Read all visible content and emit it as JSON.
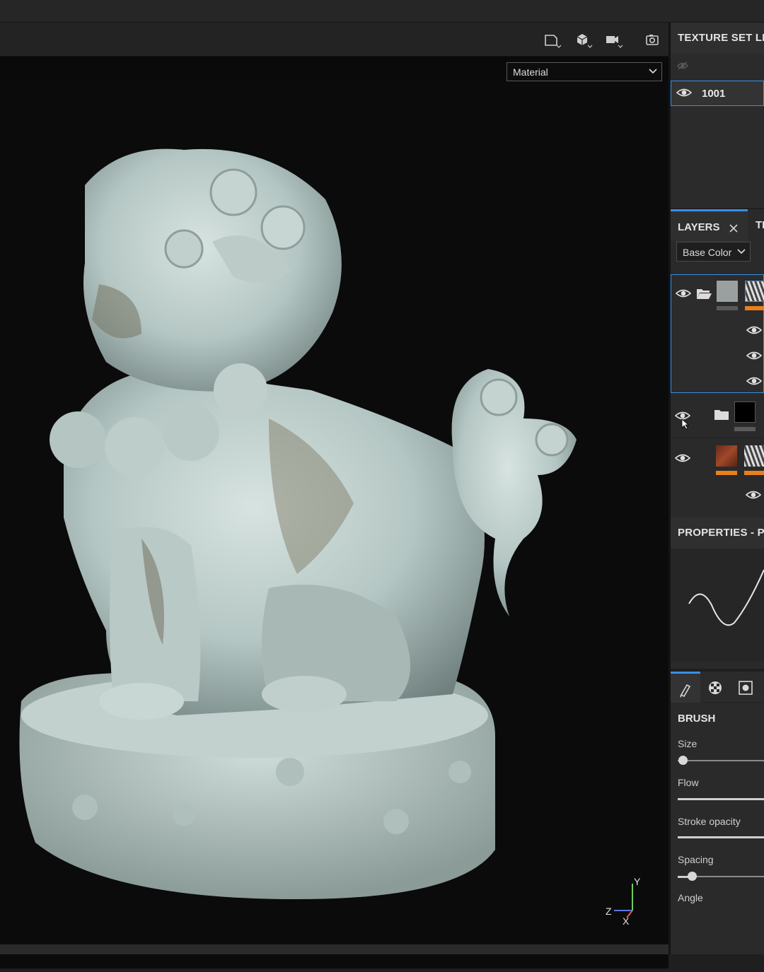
{
  "viewport": {
    "material_select": "Material",
    "toolbar_icons": [
      "frame-icon",
      "cube-icon",
      "camera-icon",
      "screenshot-icon"
    ],
    "axis": {
      "y": "Y",
      "z": "Z",
      "x": "X"
    }
  },
  "texture_set_list": {
    "title": "TEXTURE SET LIS",
    "items": [
      {
        "label": "1001",
        "visible": true
      }
    ]
  },
  "layers": {
    "tab_label": "LAYERS",
    "tab2_label": "TE",
    "channel": "Base Color",
    "accent_color": "#3a8ee6",
    "bar_color": "#e8801e"
  },
  "properties": {
    "title": "PROPERTIES - PA",
    "brush_title": "BRUSH",
    "params": [
      {
        "label": "Size",
        "value": 0.05
      },
      {
        "label": "Flow",
        "value": 1.0
      },
      {
        "label": "Stroke opacity",
        "value": 1.0
      },
      {
        "label": "Spacing",
        "value": 0.15
      },
      {
        "label": "Angle"
      }
    ]
  }
}
